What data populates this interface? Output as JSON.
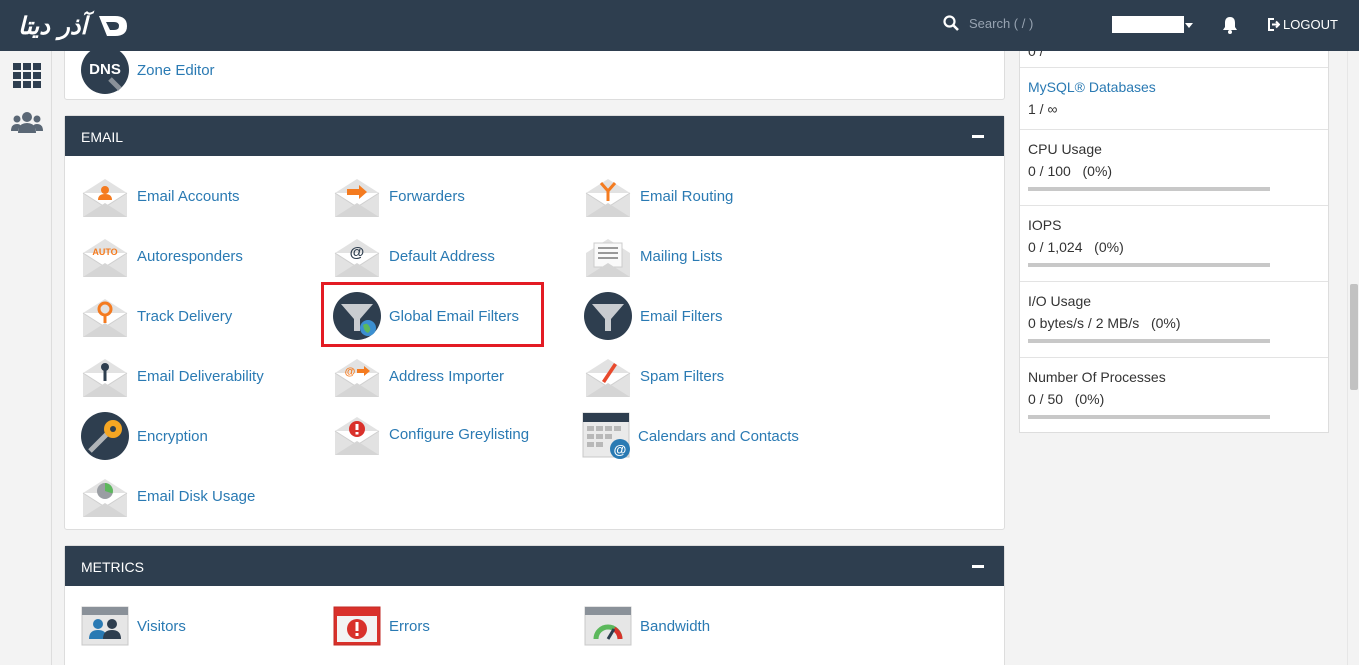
{
  "brand": {
    "logo_text": "آذر دیتا"
  },
  "header": {
    "search_placeholder": "Search ( / )",
    "logout_label": "LOGOUT"
  },
  "sidebar": {
    "items": [
      {
        "icon": "grid-icon"
      },
      {
        "icon": "users-icon"
      }
    ]
  },
  "domains_section": {
    "zone_editor": "Zone Editor",
    "dns_badge": "DNS"
  },
  "email_section": {
    "title": "EMAIL",
    "tools": [
      {
        "label": "Email Accounts",
        "icon": "email-accounts-icon"
      },
      {
        "label": "Forwarders",
        "icon": "forwarders-icon"
      },
      {
        "label": "Email Routing",
        "icon": "email-routing-icon"
      },
      {
        "label": "Autoresponders",
        "icon": "autoresponders-icon",
        "badge": "AUTO"
      },
      {
        "label": "Default Address",
        "icon": "default-address-icon"
      },
      {
        "label": "Mailing Lists",
        "icon": "mailing-lists-icon"
      },
      {
        "label": "Track Delivery",
        "icon": "track-delivery-icon"
      },
      {
        "label": "Global Email Filters",
        "icon": "global-email-filters-icon"
      },
      {
        "label": "Email Filters",
        "icon": "email-filters-icon"
      },
      {
        "label": "Email Deliverability",
        "icon": "email-deliverability-icon"
      },
      {
        "label": "Address Importer",
        "icon": "address-importer-icon"
      },
      {
        "label": "Spam Filters",
        "icon": "spam-filters-icon"
      },
      {
        "label": "Encryption",
        "icon": "encryption-icon"
      },
      {
        "label": "Configure Greylisting",
        "icon": "greylisting-icon"
      },
      {
        "label": "Calendars and Contacts",
        "icon": "calendars-contacts-icon"
      },
      {
        "label": "Email Disk Usage",
        "icon": "email-disk-usage-icon"
      }
    ]
  },
  "metrics_section": {
    "title": "METRICS",
    "tools": [
      {
        "label": "Visitors",
        "icon": "visitors-icon"
      },
      {
        "label": "Errors",
        "icon": "errors-icon"
      },
      {
        "label": "Bandwidth",
        "icon": "bandwidth-icon"
      }
    ]
  },
  "stats": {
    "partial_top_value": "0 /",
    "mysql": {
      "title": "MySQL® Databases",
      "value": "1 / ∞"
    },
    "cpu": {
      "title": "CPU Usage",
      "value": "0 / 100",
      "pct": "(0%)",
      "fill": 0
    },
    "iops": {
      "title": "IOPS",
      "value": "0 / 1,024",
      "pct": "(0%)",
      "fill": 0
    },
    "io": {
      "title": "I/O Usage",
      "value": "0 bytes/s / 2 MB/s",
      "pct": "(0%)",
      "fill": 0
    },
    "processes": {
      "title": "Number Of Processes",
      "value": "0 / 50",
      "pct": "(0%)",
      "fill": 0
    }
  },
  "colors": {
    "header_bg": "#2e3e4f",
    "link": "#2a7ab3",
    "accent_orange": "#f47b20",
    "highlight": "#e31b23"
  }
}
